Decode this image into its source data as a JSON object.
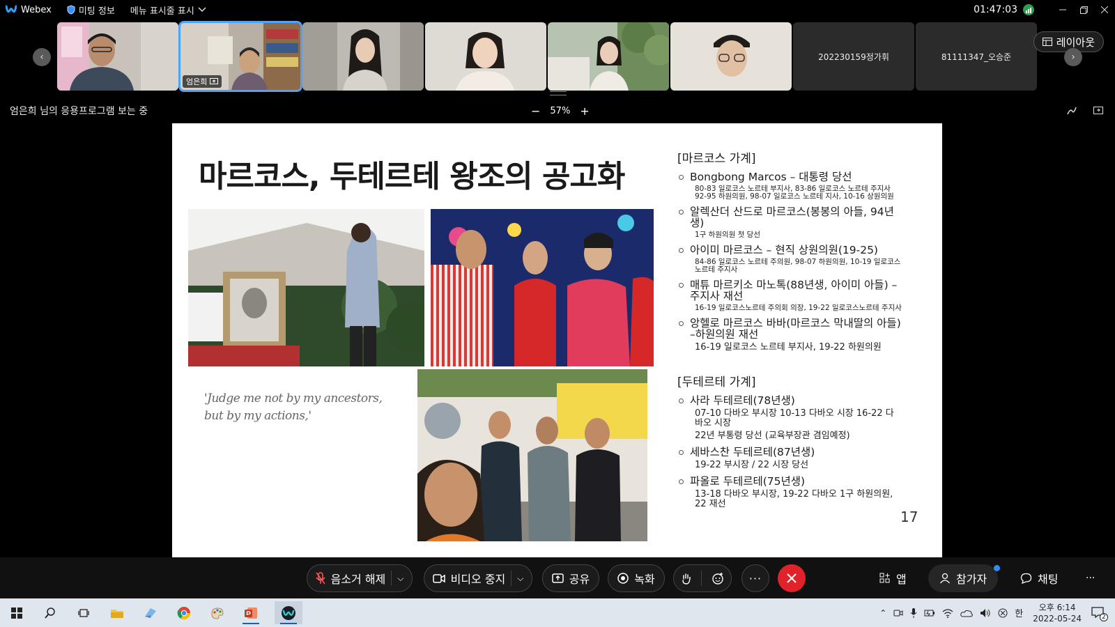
{
  "titlebar": {
    "app_name": "Webex",
    "meeting_info": "미팅 정보",
    "show_menu": "메뉴 표시줄 표시",
    "time": "01:47:03"
  },
  "participants": [
    {
      "name": ""
    },
    {
      "name": "엄은희",
      "sharing": true
    },
    {
      "name": ""
    },
    {
      "name": ""
    },
    {
      "name": ""
    },
    {
      "name": ""
    },
    {
      "name": "202230159정가휘"
    },
    {
      "name": "81111347_오승준"
    }
  ],
  "layout_label": "레이아웃",
  "share": {
    "viewing_text": "엄은희 님의 응용프로그램 보는 중",
    "zoom": "57%"
  },
  "slide": {
    "title": "마르코스, 두테르테 왕조의 공고화",
    "quote": "'Judge me not by my ancestors, but by my actions,'",
    "page_number": "17",
    "marcos_heading": "[마르코스 가계]",
    "marcos": [
      {
        "name": "Bongbong Marcos – 대통령 당선",
        "detail": "80-83 일로코스 노르테 부지사, 83-86 일로코스 노르테 주지사 92-95 하원의원, 98-07 일로코스 노르테 지사, 10-16 상원의원",
        "big": false
      },
      {
        "name": "알렉산더 산드로 마르코스(봉봉의 아들, 94년생)",
        "detail": "1구 하원의원 첫 당선",
        "big": false
      },
      {
        "name": "아이미 마르코스 – 현직 상원의원(19-25)",
        "detail": "84-86 일로코스 노르테 주의원, 98-07 하원의원, 10-19 일로코스 노르테 주지사",
        "big": false
      },
      {
        "name": "매튜 마르키소 마노톡(88년생, 아이미 아들) – 주지사 재선",
        "detail": "16-19 일로코스노르테 주의회 의장, 19-22 일로코스노르테 주지사",
        "big": false
      },
      {
        "name": "앙헬로 마르코스 바바(마르코스 막내딸의 아들) –하원의원 재선",
        "detail": "16-19 일로코스 노르테 부지사, 19-22 하원의원",
        "big": true
      }
    ],
    "duterte_heading": "[두테르테 가계]",
    "duterte": [
      {
        "name": "사라 두테르테(78년생)",
        "detail": "07-10 다바오 부시장 10-13 다바오 시장 16-22 다바오 시장",
        "detail2": "22년 부통령 당선 (교육부장관 겸임예정)"
      },
      {
        "name": "세바스찬 두테르테(87년생)",
        "detail": "19-22 부시장 / 22 시장 당선",
        "detail2": ""
      },
      {
        "name": "파올로 두테르테(75년생)",
        "detail": "13-18 다바오 부시장, 19-22 다바오 1구 하원의원, 22 재선",
        "detail2": ""
      }
    ]
  },
  "controls": {
    "unmute": "음소거 해제",
    "stop_video": "비디오 중지",
    "share": "공유",
    "record": "녹화",
    "apps": "앱",
    "participants": "참가자",
    "chat": "채팅"
  },
  "taskbar": {
    "clock_time": "오후 6:14",
    "clock_date": "2022-05-24",
    "ime": "한",
    "notifications": "2"
  },
  "colors": {
    "accent": "#4aa3ff",
    "end_call": "#e2222b",
    "slide_bg": "#ffffff"
  }
}
